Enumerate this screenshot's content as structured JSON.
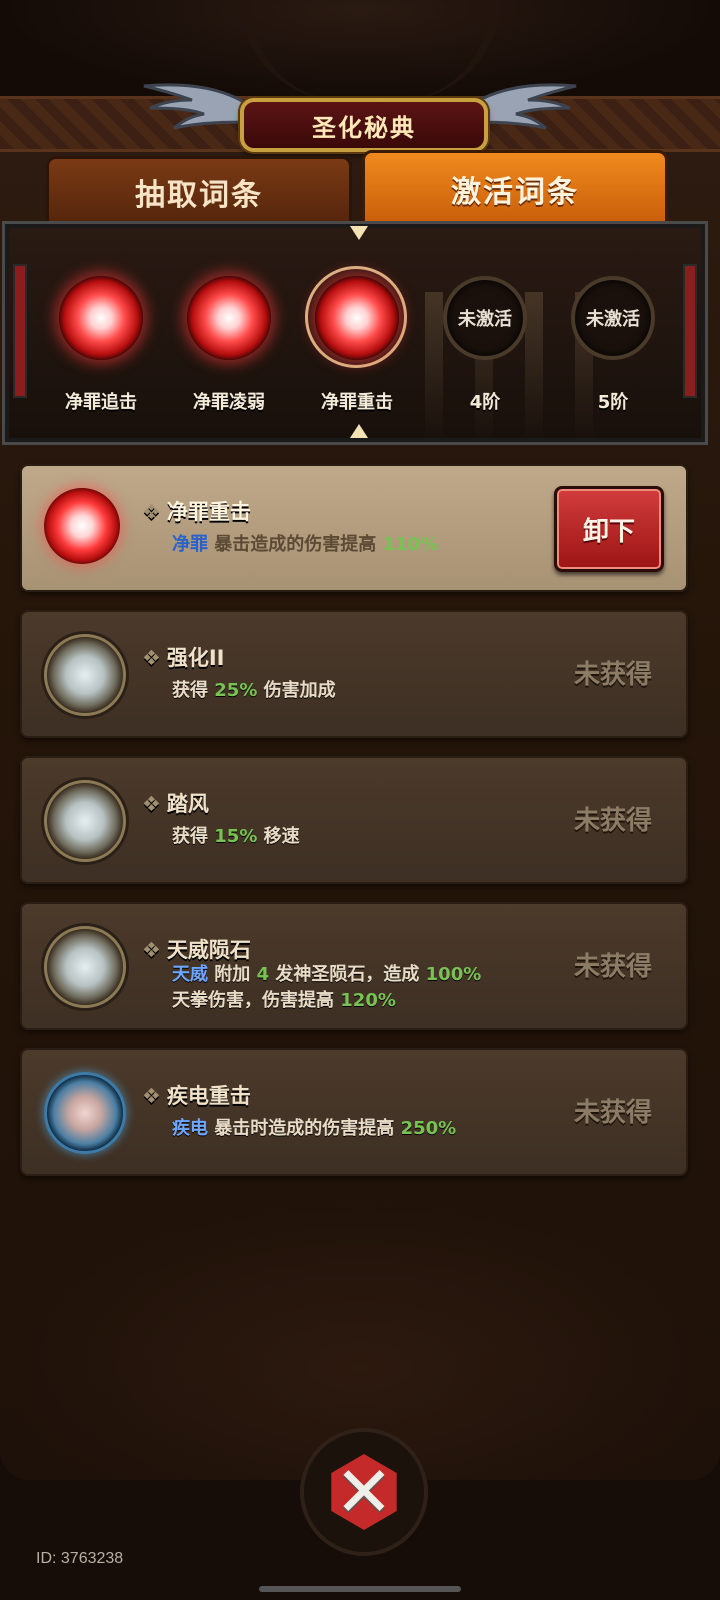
{
  "header": {
    "title": "圣化秘典"
  },
  "tabs": [
    {
      "label": "抽取词条",
      "active": false
    },
    {
      "label": "激活词条",
      "active": true
    }
  ],
  "slots": [
    {
      "label": "净罪追击",
      "state": "active"
    },
    {
      "label": "净罪凌弱",
      "state": "active"
    },
    {
      "label": "净罪重击",
      "state": "selected"
    },
    {
      "label": "4阶",
      "orb_text": "未激活",
      "state": "locked"
    },
    {
      "label": "5阶",
      "orb_text": "未激活",
      "state": "locked"
    }
  ],
  "entries": [
    {
      "name": "净罪重击",
      "tag": "净罪",
      "desc_text": "暴击造成的伤害提高",
      "value": "110%",
      "icon": "red-orb-icon",
      "action_label": "卸下"
    },
    {
      "name": "强化II",
      "prefix": "获得",
      "value": "25%",
      "suffix": "伤害加成",
      "icon": "silver-orb-icon",
      "status": "未获得"
    },
    {
      "name": "踏风",
      "prefix": "获得",
      "value": "15%",
      "suffix": "移速",
      "icon": "silver-orb-icon",
      "status": "未获得"
    },
    {
      "name": "天威陨石",
      "tag": "天威",
      "part1": "附加",
      "count": "4",
      "part2": "发神圣陨石，造成",
      "value1": "100%",
      "line2_text": "天拳伤害，伤害提高",
      "value2": "120%",
      "icon": "silver-orb-icon",
      "status": "未获得"
    },
    {
      "name": "疾电重击",
      "tag": "疾电",
      "desc_text": "暴击时造成的伤害提高",
      "value": "250%",
      "icon": "blue-orb-icon",
      "status": "未获得"
    }
  ],
  "footer": {
    "id_text": "ID: 3763238"
  },
  "colors": {
    "accent_orange": "#f08a1e",
    "button_red": "#c52a2a",
    "value_green": "#78c254",
    "tag_blue": "#6ea6ff"
  }
}
